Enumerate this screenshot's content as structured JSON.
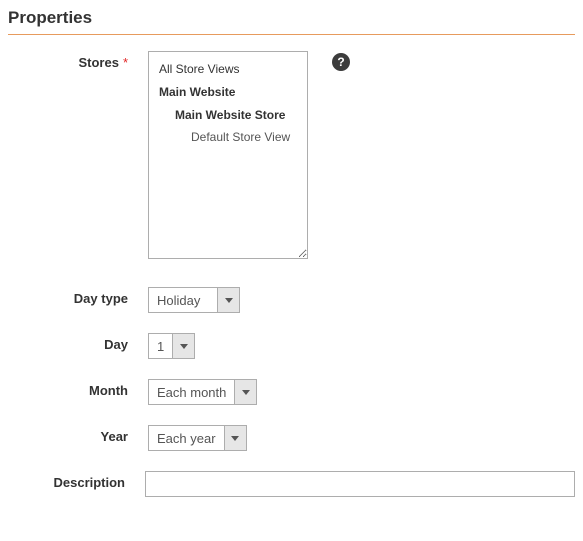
{
  "section_title": "Properties",
  "labels": {
    "stores": "Stores",
    "day_type": "Day type",
    "day": "Day",
    "month": "Month",
    "year": "Year",
    "description": "Description"
  },
  "required_mark": "*",
  "help_icon_glyph": "?",
  "stores": {
    "items": [
      {
        "label": "All Store Views",
        "level": 0
      },
      {
        "label": "Main Website",
        "level": 1
      },
      {
        "label": "Main Website Store",
        "level": 2
      },
      {
        "label": "Default Store View",
        "level": 3
      }
    ]
  },
  "fields": {
    "day_type": {
      "value": "Holiday"
    },
    "day": {
      "value": "1"
    },
    "month": {
      "value": "Each month"
    },
    "year": {
      "value": "Each year"
    },
    "description": {
      "value": ""
    }
  }
}
